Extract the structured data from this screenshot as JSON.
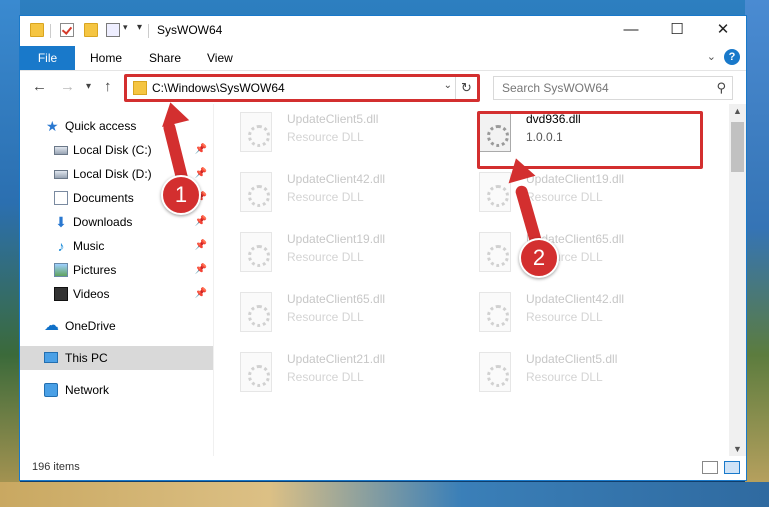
{
  "window": {
    "title": "SysWOW64"
  },
  "ribbon": {
    "tabs": [
      "File",
      "Home",
      "Share",
      "View"
    ],
    "help": "?"
  },
  "address": {
    "path": "C:\\Windows\\SysWOW64",
    "search_placeholder": "Search SysWOW64"
  },
  "nav": {
    "items": [
      {
        "label": "Quick access",
        "icon": "star-icon"
      },
      {
        "label": "Local Disk (C:)",
        "icon": "disk-icon",
        "pinned": true
      },
      {
        "label": "Local Disk (D:)",
        "icon": "disk-icon",
        "pinned": true
      },
      {
        "label": "Documents",
        "icon": "documents-icon",
        "pinned": true
      },
      {
        "label": "Downloads",
        "icon": "download-icon",
        "pinned": true
      },
      {
        "label": "Music",
        "icon": "music-icon",
        "pinned": true
      },
      {
        "label": "Pictures",
        "icon": "pictures-icon",
        "pinned": true
      },
      {
        "label": "Videos",
        "icon": "videos-icon",
        "pinned": true
      },
      {
        "label": "OneDrive",
        "icon": "onedrive-icon"
      },
      {
        "label": "This PC",
        "icon": "computer-icon",
        "selected": true
      },
      {
        "label": "Network",
        "icon": "network-icon"
      }
    ]
  },
  "files": {
    "left": [
      {
        "name": "UpdateClient5.dll",
        "type": "Resource DLL"
      },
      {
        "name": "UpdateClient42.dll",
        "type": "Resource DLL"
      },
      {
        "name": "UpdateClient19.dll",
        "type": "Resource DLL"
      },
      {
        "name": "UpdateClient65.dll",
        "type": "Resource DLL"
      },
      {
        "name": "UpdateClient21.dll",
        "type": "Resource DLL"
      }
    ],
    "right": [
      {
        "name": "dvd936.dll",
        "type": "1.0.0.1",
        "highlighted": true
      },
      {
        "name": "UpdateClient19.dll",
        "type": "Resource DLL"
      },
      {
        "name": "UpdateClient65.dll",
        "type": "Resource DLL"
      },
      {
        "name": "UpdateClient42.dll",
        "type": "Resource DLL"
      },
      {
        "name": "UpdateClient5.dll",
        "type": "Resource DLL"
      }
    ]
  },
  "status": {
    "item_count": "196 items"
  },
  "steps": {
    "one": "1",
    "two": "2"
  },
  "colors": {
    "accent": "#1979ca",
    "highlight": "#d32f2f"
  }
}
